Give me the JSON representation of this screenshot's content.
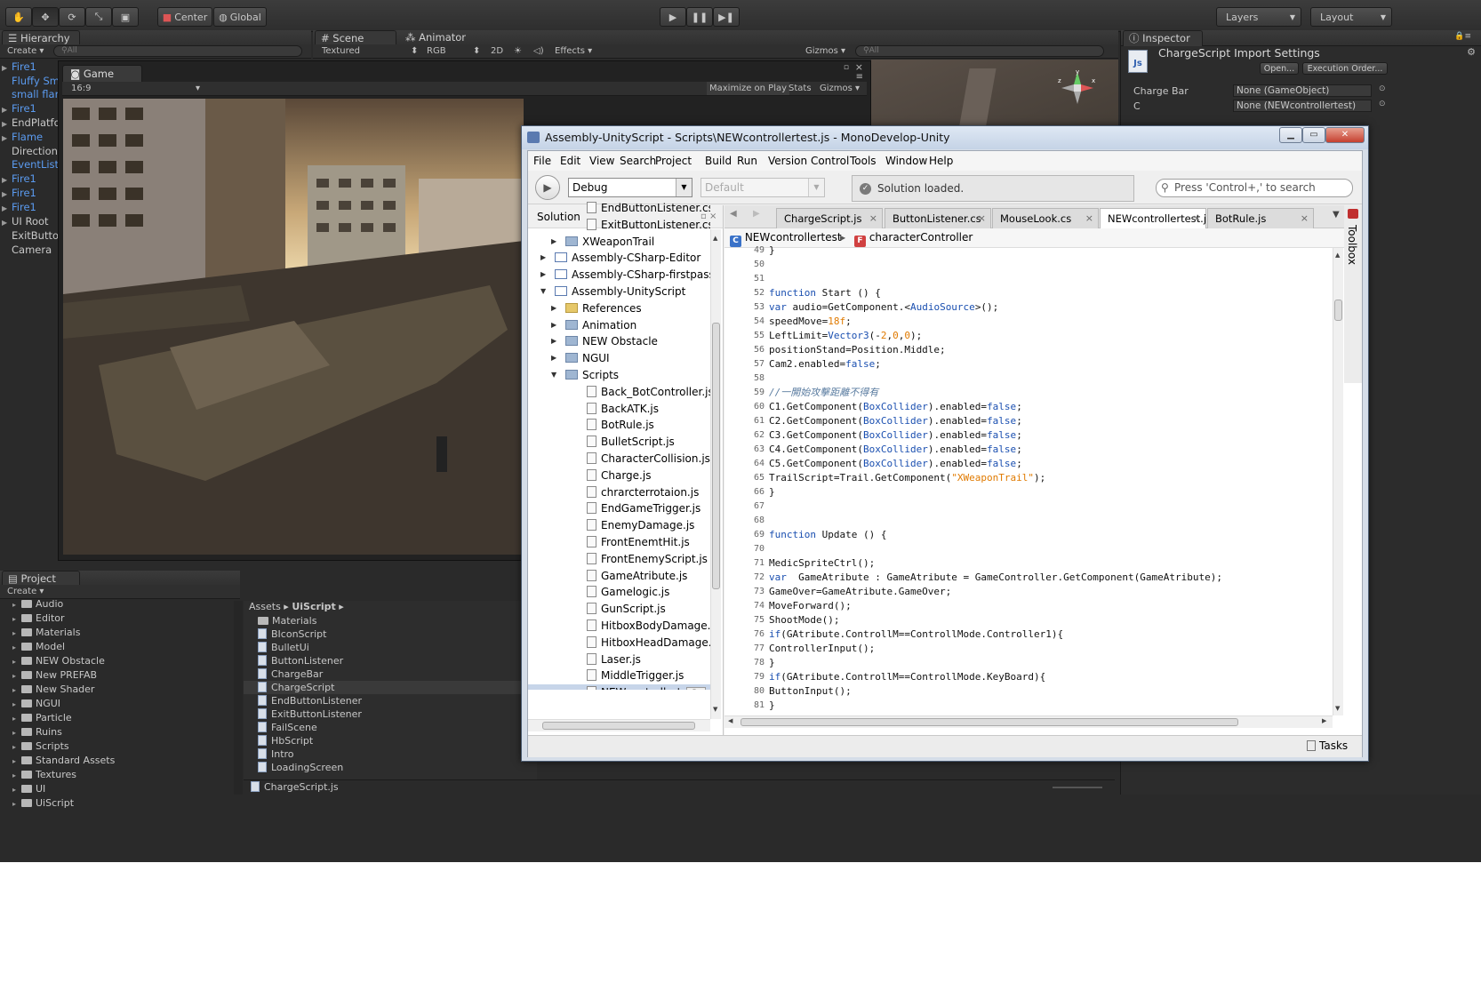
{
  "toolbar": {
    "pivot": "Center",
    "space": "Global",
    "layers": "Layers",
    "layout": "Layout"
  },
  "hierarchy": {
    "tab": "Hierarchy",
    "create": "Create",
    "search_placeholder": "All",
    "items": [
      {
        "label": "Fire1",
        "blue": true,
        "indent": false,
        "arrow": true
      },
      {
        "label": "Fluffy Sm",
        "blue": true,
        "indent": true,
        "arrow": false
      },
      {
        "label": "small flar",
        "blue": true,
        "indent": true,
        "arrow": false
      },
      {
        "label": "Fire1",
        "blue": true,
        "indent": false,
        "arrow": true
      },
      {
        "label": "EndPlatfo",
        "blue": false,
        "indent": false,
        "arrow": true
      },
      {
        "label": "Flame",
        "blue": true,
        "indent": false,
        "arrow": true
      },
      {
        "label": "Direction",
        "blue": false,
        "indent": true,
        "arrow": false
      },
      {
        "label": "EventListe",
        "blue": true,
        "indent": true,
        "arrow": false
      },
      {
        "label": "Fire1",
        "blue": true,
        "indent": false,
        "arrow": true
      },
      {
        "label": "Fire1",
        "blue": true,
        "indent": false,
        "arrow": true
      },
      {
        "label": "Fire1",
        "blue": true,
        "indent": false,
        "arrow": true
      },
      {
        "label": "UI Root",
        "blue": false,
        "indent": false,
        "arrow": true
      },
      {
        "label": "ExitButto",
        "blue": false,
        "indent": true,
        "arrow": false
      },
      {
        "label": "Camera",
        "blue": false,
        "indent": true,
        "arrow": false
      }
    ]
  },
  "scene": {
    "tab": "Scene",
    "animator_tab": "Animator",
    "shading": "Textured",
    "render": "RGB",
    "mode2d": "2D",
    "effects": "Effects",
    "gizmos": "Gizmos",
    "search_placeholder": "All"
  },
  "game": {
    "tab": "Game",
    "aspect": "16:9",
    "maximize": "Maximize on Play",
    "stats": "Stats",
    "gizmos": "Gizmos"
  },
  "project": {
    "tab": "Project",
    "create": "Create",
    "folders": [
      "Audio",
      "Editor",
      "Materials",
      "Model",
      "NEW Obstacle",
      "New PREFAB",
      "New Shader",
      "NGUI",
      "Particle",
      "Ruins",
      "Scripts",
      "Standard Assets",
      "Textures",
      "UI",
      "UiScript"
    ],
    "breadcrumb_root": "Assets",
    "breadcrumb_current": "UiScript",
    "assets": [
      {
        "label": "Materials",
        "type": "folder"
      },
      {
        "label": "BIconScript",
        "type": "js"
      },
      {
        "label": "BulletUi",
        "type": "js"
      },
      {
        "label": "ButtonListener",
        "type": "js"
      },
      {
        "label": "ChargeBar",
        "type": "js"
      },
      {
        "label": "ChargeScript",
        "type": "js",
        "selected": true
      },
      {
        "label": "EndButtonListener",
        "type": "js"
      },
      {
        "label": "ExitButtonListener",
        "type": "js"
      },
      {
        "label": "FailScene",
        "type": "js"
      },
      {
        "label": "HbScript",
        "type": "js"
      },
      {
        "label": "Intro",
        "type": "js"
      },
      {
        "label": "LoadingScreen",
        "type": "js"
      }
    ],
    "footer_file": "ChargeScript.js"
  },
  "inspector": {
    "tab": "Inspector",
    "title": "ChargeScript Import Settings",
    "open": "Open...",
    "execution_order": "Execution Order...",
    "fields": [
      {
        "label": "Charge Bar",
        "value": "None (GameObject)"
      },
      {
        "label": "C",
        "value": "None (NEWcontrollertest)"
      }
    ]
  },
  "monodevelop": {
    "title": "Assembly-UnityScript - Scripts\\NEWcontrollertest.js - MonoDevelop-Unity",
    "menu": [
      "File",
      "Edit",
      "View",
      "Search",
      "Project",
      "Build",
      "Run",
      "Version Control",
      "Tools",
      "Window",
      "Help"
    ],
    "config": "Debug",
    "platform": "Default",
    "status": "Solution loaded.",
    "search_placeholder": "Press 'Control+,' to search",
    "solution_title": "Solution",
    "tree": [
      {
        "label": "EndButtonListener.cs",
        "level": 3,
        "icon": "file",
        "expander": ""
      },
      {
        "label": "ExitButtonListener.cs",
        "level": 3,
        "icon": "file",
        "expander": ""
      },
      {
        "label": "XWeaponTrail",
        "level": 2,
        "icon": "folder",
        "expander": "right"
      },
      {
        "label": "Assembly-CSharp-Editor",
        "level": 1,
        "icon": "project",
        "expander": "right"
      },
      {
        "label": "Assembly-CSharp-firstpass",
        "level": 1,
        "icon": "project",
        "expander": "right"
      },
      {
        "label": "Assembly-UnityScript",
        "level": 1,
        "icon": "project",
        "expander": "down"
      },
      {
        "label": "References",
        "level": 2,
        "icon": "refs",
        "expander": "right"
      },
      {
        "label": "Animation",
        "level": 2,
        "icon": "folder",
        "expander": "right"
      },
      {
        "label": "NEW Obstacle",
        "level": 2,
        "icon": "folder",
        "expander": "right"
      },
      {
        "label": "NGUI",
        "level": 2,
        "icon": "folder",
        "expander": "right"
      },
      {
        "label": "Scripts",
        "level": 2,
        "icon": "folder",
        "expander": "down"
      },
      {
        "label": "Back_BotController.js",
        "level": 3,
        "icon": "file",
        "expander": ""
      },
      {
        "label": "BackATK.js",
        "level": 3,
        "icon": "file",
        "expander": ""
      },
      {
        "label": "BotRule.js",
        "level": 3,
        "icon": "file",
        "expander": ""
      },
      {
        "label": "BulletScript.js",
        "level": 3,
        "icon": "file",
        "expander": ""
      },
      {
        "label": "CharacterCollision.js",
        "level": 3,
        "icon": "file",
        "expander": ""
      },
      {
        "label": "Charge.js",
        "level": 3,
        "icon": "file",
        "expander": ""
      },
      {
        "label": "chrarcterrotaion.js",
        "level": 3,
        "icon": "file",
        "expander": ""
      },
      {
        "label": "EndGameTrigger.js",
        "level": 3,
        "icon": "file",
        "expander": ""
      },
      {
        "label": "EnemyDamage.js",
        "level": 3,
        "icon": "file",
        "expander": ""
      },
      {
        "label": "FrontEnemtHit.js",
        "level": 3,
        "icon": "file",
        "expander": ""
      },
      {
        "label": "FrontEnemyScript.js",
        "level": 3,
        "icon": "file",
        "expander": ""
      },
      {
        "label": "GameAtribute.js",
        "level": 3,
        "icon": "file",
        "expander": ""
      },
      {
        "label": "Gamelogic.js",
        "level": 3,
        "icon": "file",
        "expander": ""
      },
      {
        "label": "GunScript.js",
        "level": 3,
        "icon": "file",
        "expander": ""
      },
      {
        "label": "HitboxBodyDamage.js",
        "level": 3,
        "icon": "file",
        "expander": ""
      },
      {
        "label": "HitboxHeadDamage.js",
        "level": 3,
        "icon": "file",
        "expander": ""
      },
      {
        "label": "Laser.js",
        "level": 3,
        "icon": "file",
        "expander": ""
      },
      {
        "label": "MiddleTrigger.js",
        "level": 3,
        "icon": "file",
        "expander": ""
      },
      {
        "label": "NEWcontrollertest.js",
        "level": 3,
        "icon": "file",
        "expander": "",
        "selected": true
      }
    ],
    "tabs": [
      {
        "label": "ChargeScript.js",
        "active": false
      },
      {
        "label": "ButtonListener.cs",
        "active": false
      },
      {
        "label": "MouseLook.cs",
        "active": false
      },
      {
        "label": "NEWcontrollertest.js",
        "active": true
      },
      {
        "label": "BotRule.js",
        "active": false
      }
    ],
    "breadcrumb_class": "NEWcontrollertest",
    "breadcrumb_member": "characterController",
    "toolbox": "Toolbox",
    "tasks": "Tasks",
    "code": [
      {
        "n": "49",
        "tokens": [
          [
            "p",
            "}"
          ]
        ]
      },
      {
        "n": "50",
        "tokens": []
      },
      {
        "n": "51",
        "tokens": []
      },
      {
        "n": "52",
        "tokens": [
          [
            "kw",
            "function"
          ],
          [
            "p",
            " Start () {"
          ]
        ]
      },
      {
        "n": "53",
        "tokens": [
          [
            "kw",
            "var"
          ],
          [
            "p",
            " audio=GetComponent.<"
          ],
          [
            "ty",
            "AudioSource"
          ],
          [
            "p",
            ">();"
          ]
        ]
      },
      {
        "n": "54",
        "tokens": [
          [
            "p",
            "speedMove="
          ],
          [
            "nu",
            "18f"
          ],
          [
            "p",
            ";"
          ]
        ]
      },
      {
        "n": "55",
        "tokens": [
          [
            "p",
            "LeftLimit="
          ],
          [
            "ty",
            "Vector3"
          ],
          [
            "p",
            "(-"
          ],
          [
            "nu",
            "2"
          ],
          [
            "p",
            ","
          ],
          [
            "nu",
            "0"
          ],
          [
            "p",
            ","
          ],
          [
            "nu",
            "0"
          ],
          [
            "p",
            ");"
          ]
        ]
      },
      {
        "n": "56",
        "tokens": [
          [
            "p",
            "positionStand=Position.Middle;"
          ]
        ]
      },
      {
        "n": "57",
        "tokens": [
          [
            "p",
            "Cam2.enabled="
          ],
          [
            "kw",
            "false"
          ],
          [
            "p",
            ";"
          ]
        ]
      },
      {
        "n": "58",
        "tokens": []
      },
      {
        "n": "59",
        "tokens": [
          [
            "cm",
            "//一開始攻擊距離不得有"
          ]
        ]
      },
      {
        "n": "60",
        "tokens": [
          [
            "p",
            "C1.GetComponent("
          ],
          [
            "ty",
            "BoxCollider"
          ],
          [
            "p",
            ").enabled="
          ],
          [
            "kw",
            "false"
          ],
          [
            "p",
            ";"
          ]
        ]
      },
      {
        "n": "61",
        "tokens": [
          [
            "p",
            "C2.GetComponent("
          ],
          [
            "ty",
            "BoxCollider"
          ],
          [
            "p",
            ").enabled="
          ],
          [
            "kw",
            "false"
          ],
          [
            "p",
            ";"
          ]
        ]
      },
      {
        "n": "62",
        "tokens": [
          [
            "p",
            "C3.GetComponent("
          ],
          [
            "ty",
            "BoxCollider"
          ],
          [
            "p",
            ").enabled="
          ],
          [
            "kw",
            "false"
          ],
          [
            "p",
            ";"
          ]
        ]
      },
      {
        "n": "63",
        "tokens": [
          [
            "p",
            "C4.GetComponent("
          ],
          [
            "ty",
            "BoxCollider"
          ],
          [
            "p",
            ").enabled="
          ],
          [
            "kw",
            "false"
          ],
          [
            "p",
            ";"
          ]
        ]
      },
      {
        "n": "64",
        "tokens": [
          [
            "p",
            "C5.GetComponent("
          ],
          [
            "ty",
            "BoxCollider"
          ],
          [
            "p",
            ").enabled="
          ],
          [
            "kw",
            "false"
          ],
          [
            "p",
            ";"
          ]
        ]
      },
      {
        "n": "65",
        "tokens": [
          [
            "p",
            "TrailScript=Trail.GetComponent("
          ],
          [
            "st",
            "\"XWeaponTrail\""
          ],
          [
            "p",
            ");"
          ]
        ]
      },
      {
        "n": "66",
        "tokens": [
          [
            "p",
            "}"
          ]
        ]
      },
      {
        "n": "67",
        "tokens": []
      },
      {
        "n": "68",
        "tokens": []
      },
      {
        "n": "69",
        "tokens": [
          [
            "kw",
            "function"
          ],
          [
            "p",
            " Update () {"
          ]
        ]
      },
      {
        "n": "70",
        "tokens": []
      },
      {
        "n": "71",
        "tokens": [
          [
            "p",
            "MedicSpriteCtrl();"
          ]
        ]
      },
      {
        "n": "72",
        "tokens": [
          [
            "kw",
            "var"
          ],
          [
            "p",
            "  GameAtribute : GameAtribute = GameController.GetComponent(GameAtribute);"
          ]
        ]
      },
      {
        "n": "73",
        "tokens": [
          [
            "p",
            "GameOver=GameAtribute.GameOver;"
          ]
        ]
      },
      {
        "n": "74",
        "tokens": [
          [
            "p",
            "MoveForward();"
          ]
        ]
      },
      {
        "n": "75",
        "tokens": [
          [
            "p",
            "ShootMode();"
          ]
        ]
      },
      {
        "n": "76",
        "tokens": [
          [
            "kw",
            "if"
          ],
          [
            "p",
            "(GAtribute.ControllM==ControllMode.Controller1){"
          ]
        ]
      },
      {
        "n": "77",
        "tokens": [
          [
            "p",
            "ControllerInput();"
          ]
        ]
      },
      {
        "n": "78",
        "tokens": [
          [
            "p",
            "}"
          ]
        ]
      },
      {
        "n": "79",
        "tokens": [
          [
            "kw",
            "if"
          ],
          [
            "p",
            "(GAtribute.ControllM==ControllMode.KeyBoard){"
          ]
        ]
      },
      {
        "n": "80",
        "tokens": [
          [
            "p",
            "ButtonInput();"
          ]
        ]
      },
      {
        "n": "81",
        "tokens": [
          [
            "p",
            "}"
          ]
        ]
      }
    ]
  }
}
